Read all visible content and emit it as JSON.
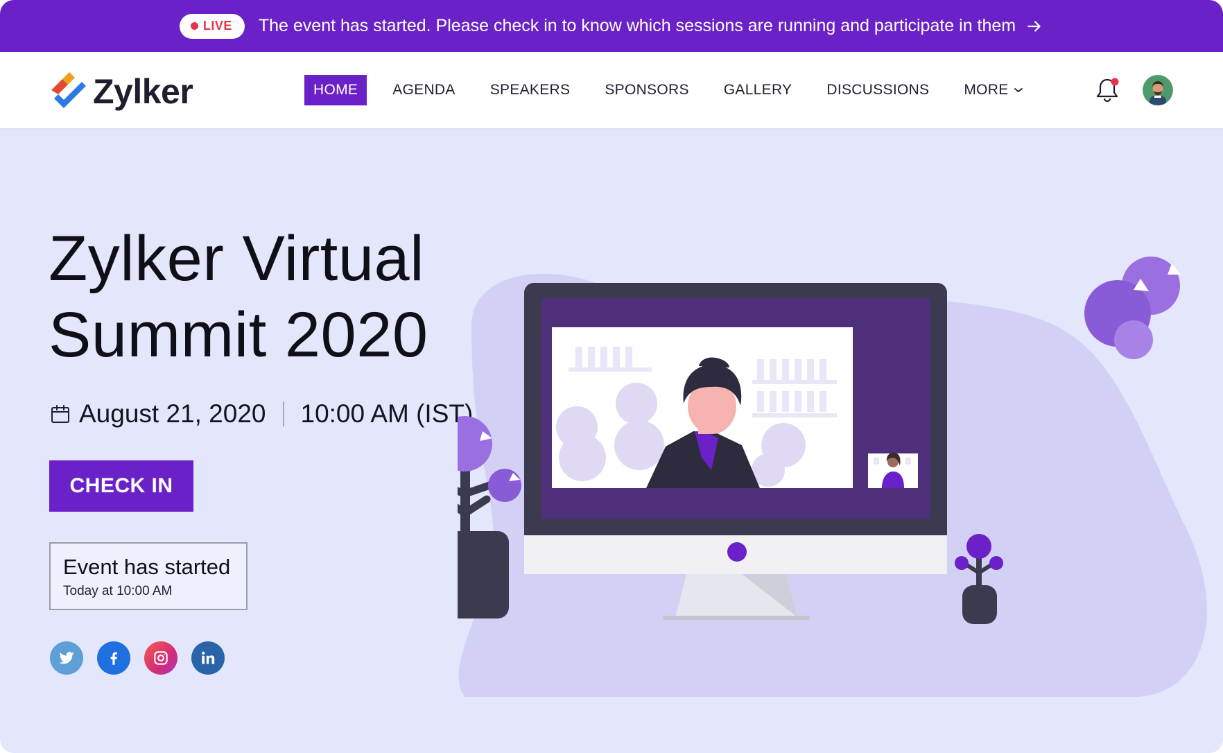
{
  "banner": {
    "live_label": "LIVE",
    "message": "The event has started. Please check in to know which sessions are running and participate in them"
  },
  "brand": {
    "name": "Zylker"
  },
  "nav": {
    "items": [
      {
        "label": "HOME",
        "active": true
      },
      {
        "label": "AGENDA"
      },
      {
        "label": "SPEAKERS"
      },
      {
        "label": "SPONSORS"
      },
      {
        "label": "GALLERY"
      },
      {
        "label": "DISCUSSIONS"
      },
      {
        "label": "MORE"
      }
    ]
  },
  "hero": {
    "title_line1": "Zylker Virtual",
    "title_line2": "Summit 2020",
    "date": "August 21, 2020",
    "time": "10:00 AM (IST)",
    "checkin_label": "CHECK IN",
    "status_title": "Event has started",
    "status_sub": "Today at 10:00 AM"
  },
  "icons": {
    "social": [
      "twitter-icon",
      "facebook-icon",
      "instagram-icon",
      "linkedin-icon"
    ]
  },
  "colors": {
    "accent": "#6a22c8",
    "live": "#e8344a",
    "background": "#e4e6fb"
  }
}
